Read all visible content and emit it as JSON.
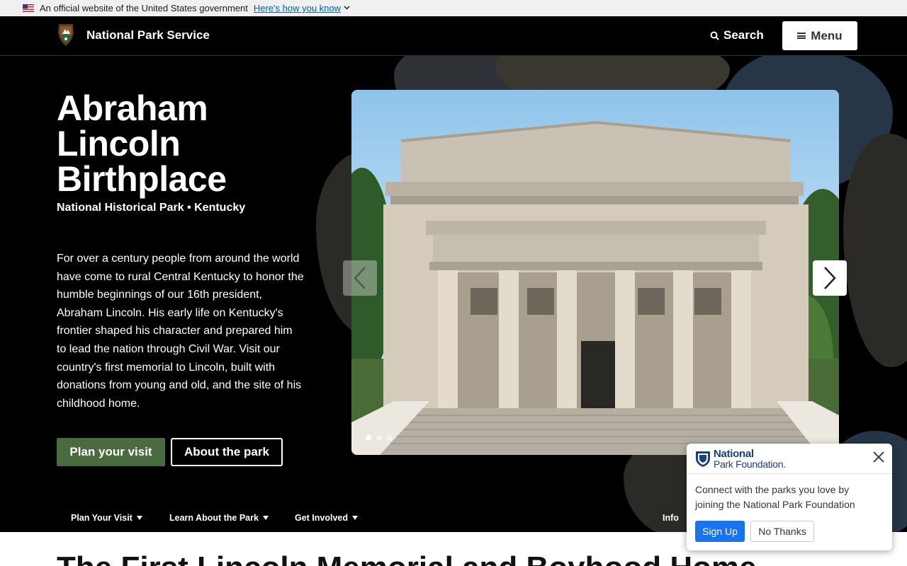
{
  "gov_banner": {
    "text": "An official website of the United States government",
    "link": "Here's how you know"
  },
  "header": {
    "brand": "National Park Service",
    "search_label": "Search",
    "menu_label": "Menu"
  },
  "hero": {
    "title": "Abraham Lincoln Birthplace",
    "subtitle": "National Historical Park • Kentucky",
    "description": "For over a century people from around the world have come to rural Central Kentucky to honor the humble beginnings of our 16th president, Abraham Lincoln. His early life on Kentucky's frontier shaped his character and prepared him to lead the nation through Civil War. Visit our country's first memorial to Lincoln, built with donations from young and old, and the site of his childhood home.",
    "primary_button": "Plan your visit",
    "secondary_button": "About the park",
    "carousel": {
      "slide_count": 3,
      "active_index": 0
    }
  },
  "subnav": {
    "items": [
      {
        "label": "Plan Your Visit",
        "has_dropdown": true
      },
      {
        "label": "Learn About the Park",
        "has_dropdown": true
      },
      {
        "label": "Get Involved",
        "has_dropdown": true
      },
      {
        "label": "Info",
        "has_dropdown": false
      }
    ]
  },
  "main": {
    "section_heading": "The First Lincoln Memorial and Boyhood Home"
  },
  "popup": {
    "logo_line1": "National",
    "logo_line2": "Park Foundation.",
    "message": "Connect with the parks you love by joining the National Park Foundation",
    "signup_label": "Sign Up",
    "nothanks_label": "No Thanks"
  },
  "colors": {
    "accent_green": "#4a6b3f",
    "npf_blue": "#1c3f7a",
    "signup_blue": "#1a73e8",
    "gov_link": "#005ea2"
  }
}
